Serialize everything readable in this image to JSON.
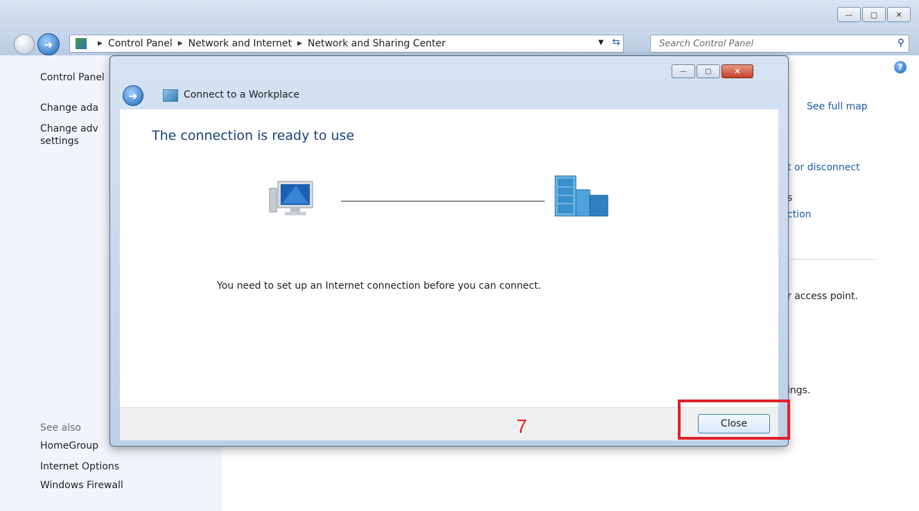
{
  "explorer": {
    "breadcrumbs": [
      "Control Panel",
      "Network and Internet",
      "Network and Sharing Center"
    ],
    "search_placeholder": "Search Control Panel",
    "window_buttons": [
      "—",
      "▢",
      "✕"
    ]
  },
  "left_pane": {
    "items": [
      "Control Panel",
      "Change ada",
      "Change adv",
      "settings"
    ],
    "see_also_label": "See also",
    "see_also": [
      "HomeGroup",
      "Internet Options",
      "Windows Firewall"
    ]
  },
  "right_pane": {
    "see_full_map": "See full map",
    "frag1": "t or disconnect",
    "frag2": "s",
    "frag3": "ction",
    "frag4": "r access point.",
    "frag5": "ings."
  },
  "dialog": {
    "title": "Connect to a Workplace",
    "heading": "The connection is ready to use",
    "message": "You need to set up an Internet connection before you can connect.",
    "close_label": "Close",
    "buttons": [
      "—",
      "▢",
      "✕"
    ]
  },
  "annotation": {
    "step_number": "7",
    "highlight_color": "#e0202a"
  },
  "icons": {
    "back": "back-arrow-icon",
    "forward": "forward-arrow-icon",
    "help": "help-icon",
    "search": "search-icon",
    "computer": "computer-icon",
    "server": "server-icon"
  }
}
